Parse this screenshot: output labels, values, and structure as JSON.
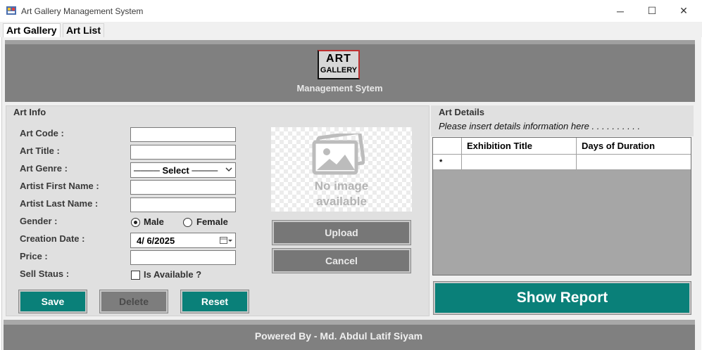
{
  "window": {
    "title": "Art Gallery Management System",
    "controls": {
      "minimize": "─",
      "maximize": "☐",
      "close": "✕"
    }
  },
  "tabs": [
    {
      "label": "Art Gallery",
      "active": true
    },
    {
      "label": "Art List",
      "active": false
    }
  ],
  "header": {
    "logo_line1": "ART",
    "logo_line2": "GALLERY",
    "subtitle": "Management Sytem"
  },
  "art_info": {
    "title": "Art Info",
    "labels": {
      "code": "Art Code :",
      "title": "Art Title :",
      "genre": "Art Genre :",
      "first_name": "Artist First Name :",
      "last_name": "Artist Last Name :",
      "gender": "Gender :",
      "creation_date": "Creation Date :",
      "price": "Price :",
      "sell_status": "Sell Staus :"
    },
    "values": {
      "code": "",
      "title": "",
      "first_name": "",
      "last_name": "",
      "price": ""
    },
    "genre_selected": "──── Select ────",
    "gender_options": {
      "male": "Male",
      "female": "Female"
    },
    "gender_selected": "Male",
    "creation_date": "4/  6/2025",
    "available_label": "Is Available ?",
    "available_checked": false,
    "buttons": {
      "save": "Save",
      "delete": "Delete",
      "reset": "Reset"
    }
  },
  "image": {
    "placeholder_line1": "No image",
    "placeholder_line2": "available",
    "upload": "Upload",
    "cancel": "Cancel"
  },
  "art_details": {
    "title": "Art Details",
    "hint": "Please insert details information here . . . . . . . . . .",
    "columns": [
      "Exhibition Title",
      "Days of Duration"
    ],
    "new_row_marker": "*"
  },
  "report_button": "Show Report",
  "footer": "Powered By - Md. Abdul Latif Siyam",
  "colors": {
    "accent": "#0a8079",
    "panel": "#808080",
    "group": "#e0e0e0"
  }
}
